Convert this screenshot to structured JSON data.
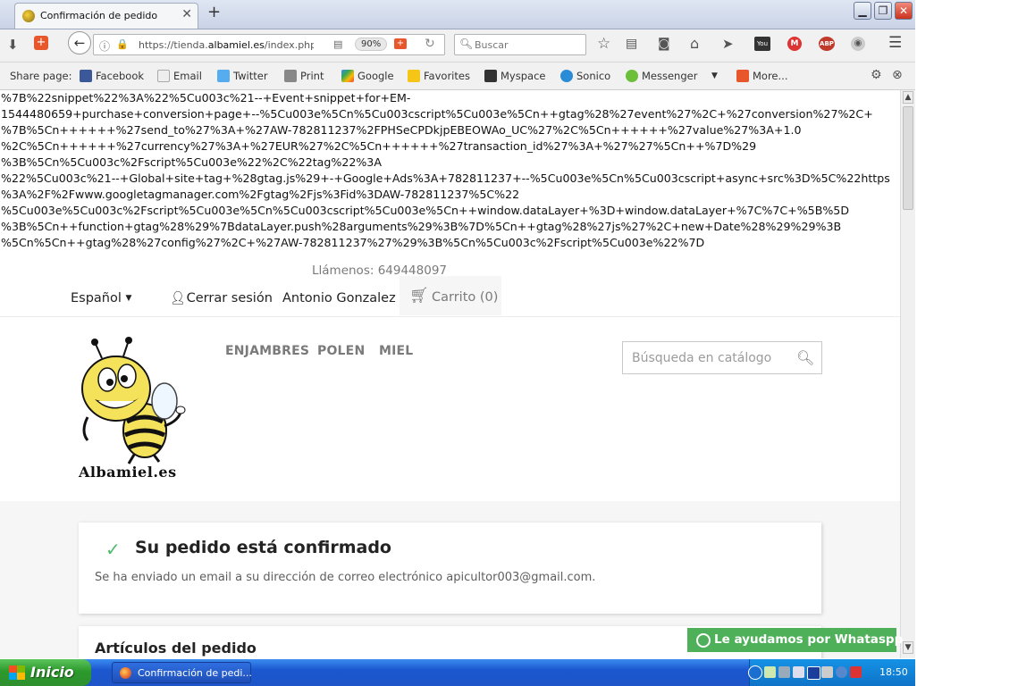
{
  "browser": {
    "tab_title": "Confirmación de pedido",
    "url_prefix": "https://tienda.",
    "url_domain": "albamiel.es",
    "url_rest": "/index.php?cor",
    "zoom": "90%",
    "search_placeholder": "Buscar"
  },
  "sharebar": {
    "label": "Share page:",
    "items": [
      "Facebook",
      "Email",
      "Twitter",
      "Print",
      "Google",
      "Favorites",
      "Myspace",
      "Sonico",
      "Messenger",
      "More..."
    ]
  },
  "code_text": "%7B%22snippet%22%3A%22%5Cu003c%21--+Event+snippet+for+EM-\n1544480659+purchase+conversion+page+--%5Cu003e%5Cn%5Cu003cscript%5Cu003e%5Cn++gtag%28%27event%27%2C+%27conversion%27%2C+\n%7B%5Cn++++++%27send_to%27%3A+%27AW-782811237%2FPHSeCPDkjpEBEOWAo_UC%27%2C%5Cn++++++%27value%27%3A+1.0\n%2C%5Cn++++++%27currency%27%3A+%27EUR%27%2C%5Cn++++++%27transaction_id%27%3A+%27%27%5Cn++%7D%29\n%3B%5Cn%5Cu003c%2Fscript%5Cu003e%22%2C%22tag%22%3A\n%22%5Cu003c%21--+Global+site+tag+%28gtag.js%29+-+Google+Ads%3A+782811237+--%5Cu003e%5Cn%5Cu003cscript+async+src%3D%5C%22https\n%3A%2F%2Fwww.googletagmanager.com%2Fgtag%2Fjs%3Fid%3DAW-782811237%5C%22\n%5Cu003e%5Cu003c%2Fscript%5Cu003e%5Cn%5Cu003cscript%5Cu003e%5Cn++window.dataLayer+%3D+window.dataLayer+%7C%7C+%5B%5D\n%3B%5Cn++function+gtag%28%29%7BdataLayer.push%28arguments%29%3B%7D%5Cn++gtag%28%27js%27%2C+new+Date%28%29%29%3B\n%5Cn%5Cn++gtag%28%27config%27%2C+%27AW-782811237%27%29%3B%5Cn%5Cu003c%2Fscript%5Cu003e%22%7D",
  "header": {
    "phone": "Llámenos: 649448097",
    "language": "Español",
    "logout": "Cerrar sesión",
    "user": "Antonio Gonzalez",
    "cart": "Carrito (0)"
  },
  "nav": {
    "items": [
      "ENJAMBRES",
      "POLEN",
      "MIEL"
    ],
    "search_placeholder": "Búsqueda en catálogo"
  },
  "logo_text": "Albamiel.es",
  "confirmation": {
    "title": "Su pedido está confirmado",
    "message": "Se ha enviado un email a su dirección de correo electrónico apicultor003@gmail.com."
  },
  "order_items_title": "Artículos del pedido",
  "whatsapp": "Le ayudamos por Whataspp",
  "taskbar": {
    "start": "Inicio",
    "item": "Confirmación de pedi...",
    "clock": "18:50"
  },
  "colors": {
    "whatsapp_green": "#4fb05a",
    "check_green": "#4cbb6c",
    "xp_blue": "#1e55c8"
  }
}
